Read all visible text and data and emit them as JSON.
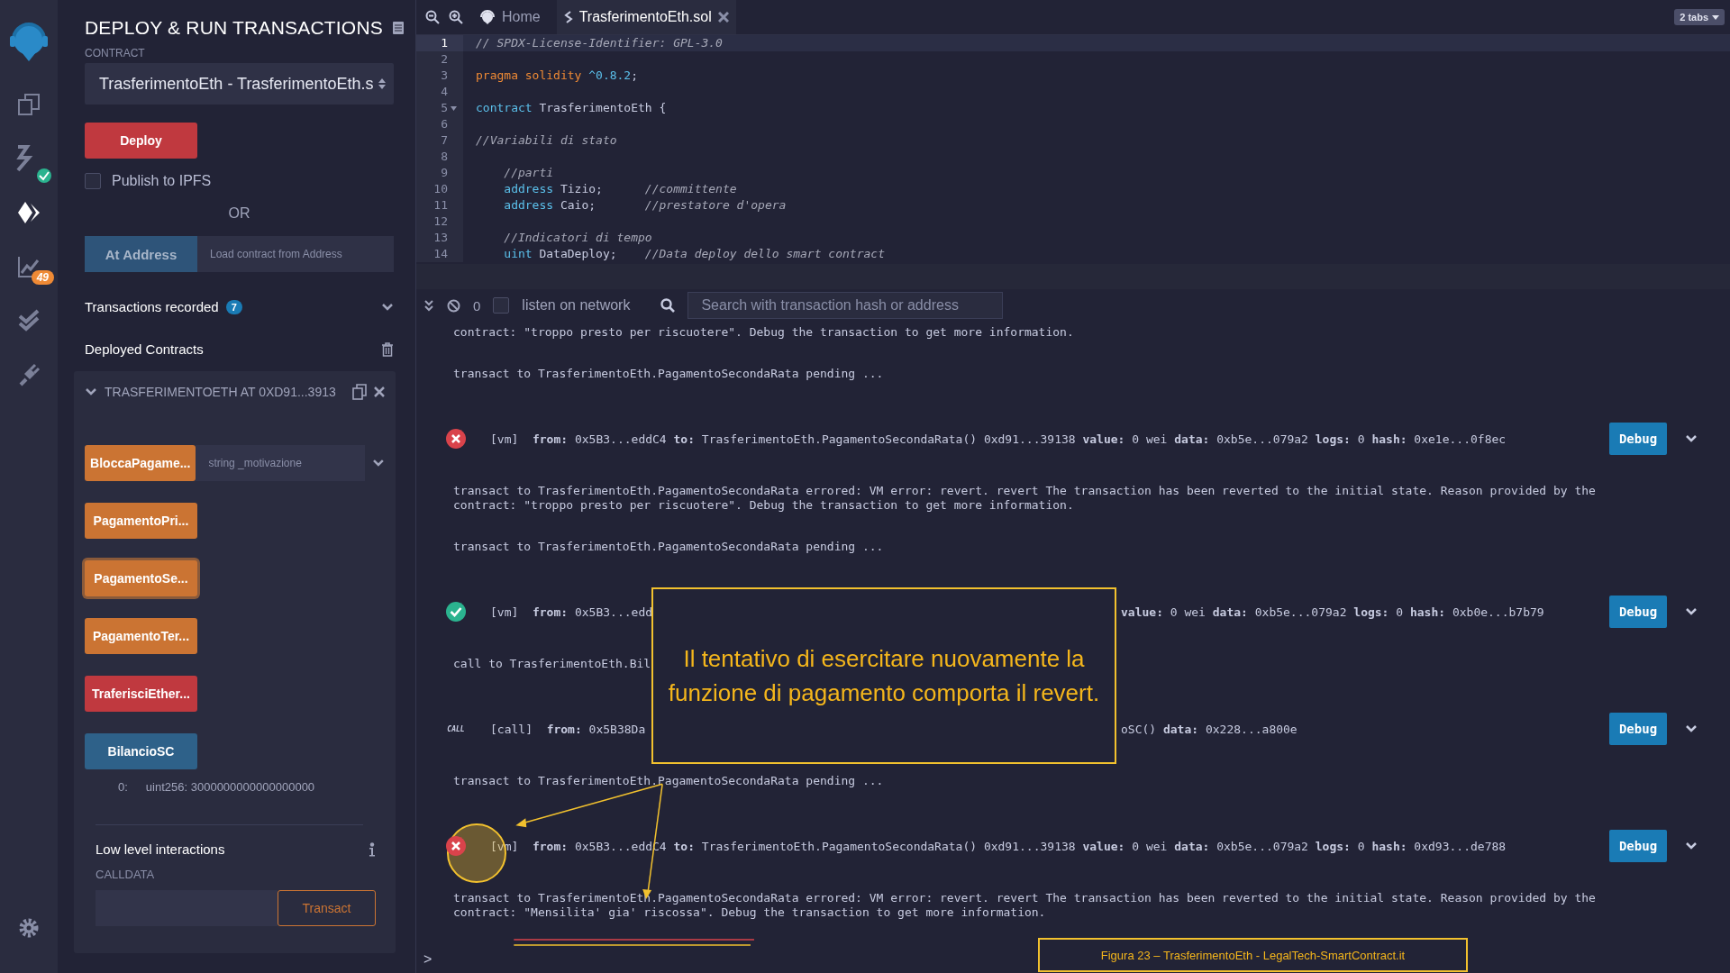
{
  "icon_bar": {
    "items": [
      {
        "kind": "logo",
        "selected": false
      },
      {
        "kind": "files",
        "selected": false
      },
      {
        "kind": "compiler",
        "selected": false,
        "check_badge": true
      },
      {
        "kind": "deploy",
        "selected": true
      },
      {
        "kind": "analysis",
        "selected": false,
        "badge": "49"
      },
      {
        "kind": "tests",
        "selected": false
      },
      {
        "kind": "plugins",
        "selected": false
      }
    ],
    "settings": {
      "kind": "settings"
    }
  },
  "side_panel": {
    "title": "DEPLOY & RUN TRANSACTIONS",
    "contract_label": "CONTRACT",
    "contract_select": "TrasferimentoEth - TrasferimentoEth.s",
    "deploy_button": "Deploy",
    "publish": {
      "label": "Publish to IPFS",
      "checked": false
    },
    "or": "OR",
    "at_address": {
      "button": "At Address",
      "placeholder": "Load contract from Address"
    },
    "transactions_recorded": {
      "label": "Transactions recorded",
      "count": "7"
    },
    "deployed_contracts": "Deployed Contracts",
    "instance": {
      "title": "TRASFERIMENTOETH AT 0XD91...3913",
      "expanded": true,
      "functions": [
        {
          "label": "BloccaPagame...",
          "kind": "transact",
          "focused": false,
          "placeholder": "string _motivazione"
        },
        {
          "label": "PagamentoPri...",
          "kind": "transact",
          "focused": false
        },
        {
          "label": "PagamentoSe...",
          "kind": "transact",
          "focused": true
        },
        {
          "label": "PagamentoTer...",
          "kind": "transact",
          "focused": false
        },
        {
          "label": "TraferisciEther...",
          "kind": "payable",
          "focused": false
        },
        {
          "label": "BilancioSC",
          "kind": "call",
          "focused": false
        }
      ],
      "result": {
        "index": "0:",
        "value": "uint256: 3000000000000000000"
      },
      "low_level": {
        "title": "Low level interactions",
        "calldata_label": "CALLDATA",
        "button": "Transact"
      }
    }
  },
  "tabs": [
    {
      "label": "Home",
      "kind": "home",
      "selected": false
    },
    {
      "label": "TrasferimentoEth.sol",
      "kind": "file",
      "selected": true
    }
  ],
  "tabs_count": "2 tabs",
  "editor": {
    "lines": [
      {
        "number": "1",
        "current": true,
        "foldable": false,
        "tokens": [
          {
            "kind": "comment",
            "text": "// SPDX-License-Identifier: GPL-3.0"
          }
        ]
      },
      {
        "number": "2",
        "current": false,
        "foldable": false
      },
      {
        "number": "3",
        "current": false,
        "foldable": false,
        "tokens": [
          {
            "kind": "keyword2",
            "text": "pragma solidity "
          },
          {
            "kind": "version",
            "text": "^0.8.2"
          },
          {
            "kind": "plain",
            "text": ";"
          }
        ]
      },
      {
        "number": "4",
        "current": false,
        "foldable": false
      },
      {
        "number": "5",
        "current": false,
        "foldable": true,
        "tokens": [
          {
            "kind": "keyword",
            "text": "contract "
          },
          {
            "kind": "plain",
            "text": "TrasferimentoEth {"
          }
        ]
      },
      {
        "number": "6",
        "current": false,
        "foldable": false
      },
      {
        "number": "7",
        "current": false,
        "foldable": false,
        "tokens": [
          {
            "kind": "comment",
            "text": "//Variabili di stato"
          }
        ]
      },
      {
        "number": "8",
        "current": false,
        "foldable": false
      },
      {
        "number": "9",
        "current": false,
        "foldable": false,
        "tokens": [
          {
            "kind": "comment",
            "text": "    //parti"
          }
        ]
      },
      {
        "number": "10",
        "current": false,
        "foldable": false,
        "tokens": [
          {
            "kind": "keyword",
            "text": "    address "
          },
          {
            "kind": "plain",
            "text": "Tizio;      "
          },
          {
            "kind": "comment",
            "text": "//committente"
          }
        ]
      },
      {
        "number": "11",
        "current": false,
        "foldable": false,
        "tokens": [
          {
            "kind": "keyword",
            "text": "    address "
          },
          {
            "kind": "plain",
            "text": "Caio;       "
          },
          {
            "kind": "comment",
            "text": "//prestatore d'opera"
          }
        ]
      },
      {
        "number": "12",
        "current": false,
        "foldable": false
      },
      {
        "number": "13",
        "current": false,
        "foldable": false,
        "tokens": [
          {
            "kind": "comment",
            "text": "    //Indicatori di tempo"
          }
        ]
      },
      {
        "number": "14",
        "current": false,
        "foldable": false,
        "tokens": [
          {
            "kind": "keyword",
            "text": "    uint "
          },
          {
            "kind": "plain",
            "text": "DataDeploy;    "
          },
          {
            "kind": "comment",
            "text": "//Data deploy dello smart contract"
          }
        ]
      }
    ]
  },
  "terminal": {
    "pending_count": "0",
    "listen": {
      "label": "listen on network",
      "checked": false
    },
    "search_placeholder": "Search with transaction hash or address",
    "entries": [
      {
        "kind": "text",
        "text": "contract: \"troppo presto per riscuotere\". Debug the transaction to get more information."
      },
      {
        "kind": "text",
        "text": "transact to TrasferimentoEth.PagamentoSecondaRata pending ..."
      },
      {
        "kind": "tx_error",
        "text": "[vm]  **from:** 0x5B3...eddC4 **to:** TrasferimentoEth.PagamentoSecondaRata() 0xd91...39138 **value:** 0 wei **data:** 0xb5e...079a2 **logs:** 0 **hash:** 0xe1e...0f8ec",
        "button": "Debug"
      },
      {
        "kind": "text",
        "text": "transact to TrasferimentoEth.PagamentoSecondaRata errored: VM error: revert. revert The transaction has been reverted to the initial state. Reason provided by the\ncontract: \"troppo presto per riscuotere\". Debug the transaction to get more information."
      },
      {
        "kind": "text",
        "text": "transact to TrasferimentoEth.PagamentoSecondaRata pending ..."
      },
      {
        "kind": "tx_success",
        "text": "[vm]  **from:** 0x5B3...edd",
        "text_right": "**value:** 0 wei **data:** 0xb5e...079a2 **logs:** 0 **hash:** 0xb0e...b7b79",
        "button": "Debug"
      },
      {
        "kind": "text",
        "text": "call to TrasferimentoEth.Bil"
      },
      {
        "kind": "tx_call",
        "icon_text": "CALL",
        "text": "[call]  **from:** 0x5B38Da",
        "text_right": "oSC() **data:** 0x228...a800e",
        "button": "Debug"
      },
      {
        "kind": "text",
        "text": "transact to TrasferimentoEth.PagamentoSecondaRata pending ..."
      },
      {
        "kind": "tx_error",
        "highlighted": true,
        "text": "[vm]  **from:** 0x5B3...eddC4 **to:** TrasferimentoEth.PagamentoSecondaRata() 0xd91...39138 **value:** 0 wei **data:** 0xb5e...079a2 **logs:** 0 **hash:** 0xd93...de788",
        "button": "Debug"
      },
      {
        "kind": "text",
        "text": "transact to TrasferimentoEth.PagamentoSecondaRata errored: VM error: revert. revert The transaction has been reverted to the initial state. Reason provided by the\ncontract: \"Mensilita' gia' riscossa\". Debug the transaction to get more information."
      }
    ],
    "prompt": ">"
  },
  "annotation": {
    "callout": "Il tentativo di esercitare nuovamente la funzione di pagamento comporta il revert.",
    "caption": "Figura 23 – TrasferimentoEth - LegalTech-SmartContract.it"
  }
}
